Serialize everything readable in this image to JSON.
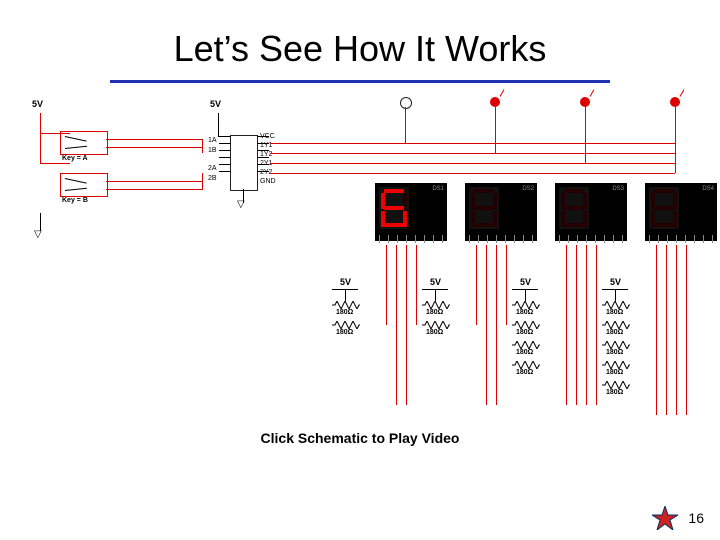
{
  "slide": {
    "title": "Let’s See How It Works",
    "caption": "Click Schematic to Play Video",
    "page_number": "16"
  },
  "supply_label": "5V",
  "switches": {
    "a_label": "Key = A",
    "b_label": "Key = B"
  },
  "ic": {
    "left_pins": [
      "1A",
      "1B",
      "2A",
      "2B"
    ],
    "right_pins": [
      "VCC",
      "1Y1",
      "1Y2",
      "2Y1",
      "2Y2",
      "GND"
    ]
  },
  "leds": [
    {
      "on": false
    },
    {
      "on": true
    },
    {
      "on": true
    },
    {
      "on": true
    }
  ],
  "displays": [
    {
      "label": "DS1",
      "segments": {
        "a": true,
        "b": false,
        "c": true,
        "d": true,
        "e": true,
        "f": true,
        "g": true
      }
    },
    {
      "label": "DS2",
      "segments": {
        "a": false,
        "b": false,
        "c": false,
        "d": false,
        "e": false,
        "f": false,
        "g": false
      }
    },
    {
      "label": "DS3",
      "segments": {
        "a": false,
        "b": false,
        "c": false,
        "d": false,
        "e": false,
        "f": false,
        "g": false
      }
    },
    {
      "label": "DS4",
      "segments": {
        "a": false,
        "b": false,
        "c": false,
        "d": false,
        "e": false,
        "f": false,
        "g": false
      }
    }
  ],
  "resistor_banks": [
    {
      "supply": "5V",
      "values": [
        "180Ω",
        "180Ω"
      ]
    },
    {
      "supply": "5V",
      "values": [
        "180Ω",
        "180Ω"
      ]
    },
    {
      "supply": "5V",
      "values": [
        "180Ω",
        "180Ω",
        "180Ω",
        "180Ω"
      ]
    },
    {
      "supply": "5V",
      "values": [
        "180Ω",
        "180Ω",
        "180Ω",
        "180Ω",
        "180Ω"
      ]
    }
  ]
}
